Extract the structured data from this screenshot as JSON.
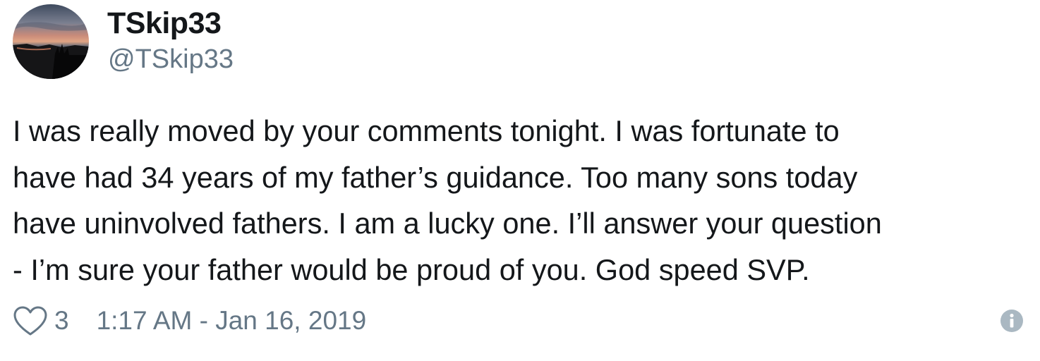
{
  "user": {
    "display_name": "TSkip33",
    "handle": "@TSkip33"
  },
  "tweet": {
    "lines": [
      "I was really moved by your comments tonight. I was fortunate to",
      "have had 34 years of my father’s guidance. Too many sons today",
      "have uninvolved fathers. I am a lucky one. I’ll answer your question",
      "- I’m sure your father would be proud of you. God speed SVP."
    ]
  },
  "footer": {
    "like_icon": "heart-icon",
    "like_count": "3",
    "timestamp": "1:17 AM - Jan 16, 2019",
    "info_icon": "info-icon"
  },
  "colors": {
    "text": "#14171a",
    "muted": "#657786",
    "info_icon": "#aab8c2"
  }
}
